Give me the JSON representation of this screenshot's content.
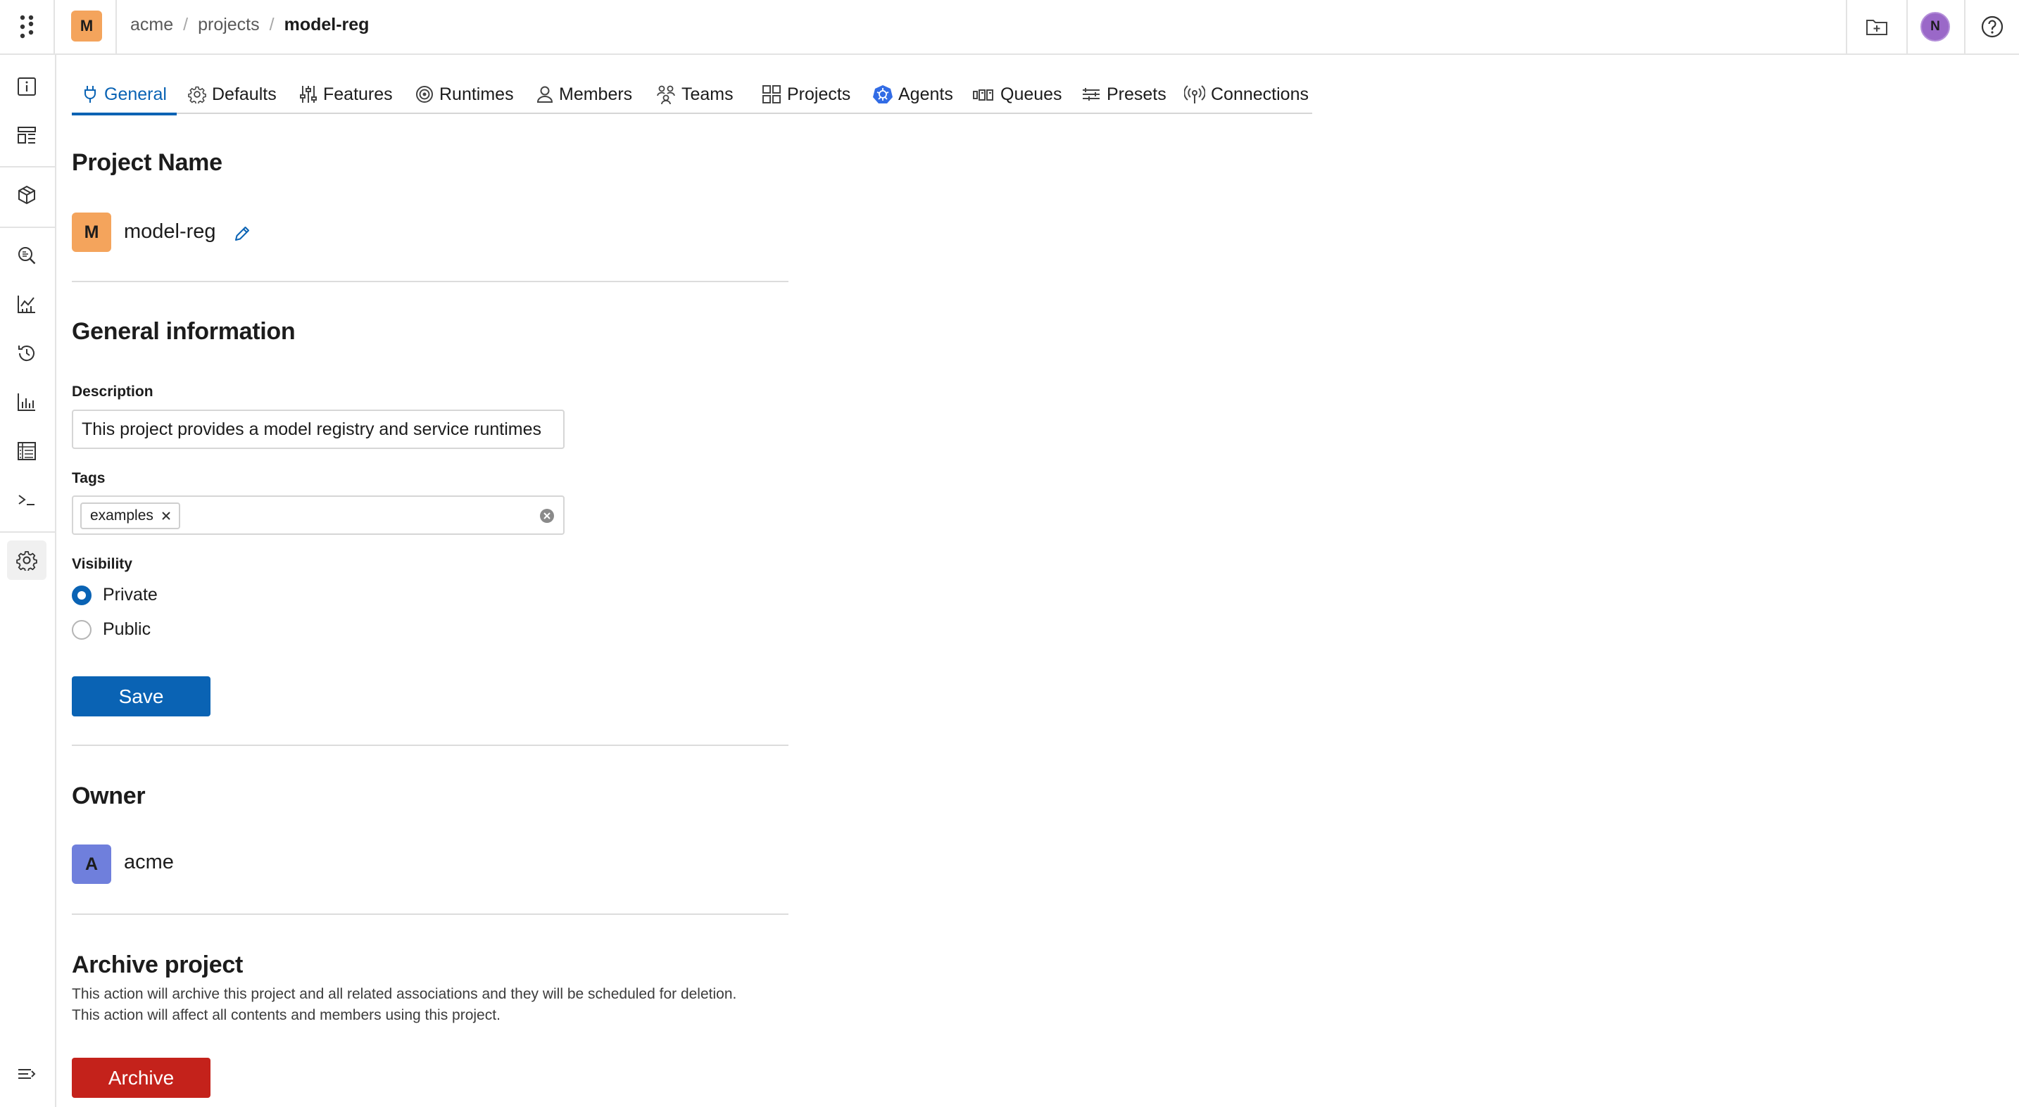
{
  "header": {
    "project_badge": "M",
    "breadcrumbs": [
      "acme",
      "projects",
      "model-reg"
    ],
    "separator": "/",
    "user_avatar": "N",
    "icons": [
      "apps-grid-icon",
      "new-folder-icon",
      "help-icon"
    ]
  },
  "sidebar": {
    "items": [
      {
        "icon": "info-icon"
      },
      {
        "icon": "dashboard-layout-icon"
      },
      {
        "icon": "package-icon"
      },
      {
        "icon": "search-report-icon"
      },
      {
        "icon": "line-chart-icon"
      },
      {
        "icon": "history-icon"
      },
      {
        "icon": "bar-chart-icon"
      },
      {
        "icon": "table-icon"
      },
      {
        "icon": "terminal-icon"
      },
      {
        "icon": "settings-icon",
        "active": true
      }
    ],
    "collapse_icon": "expand-sidebar-icon"
  },
  "tabs": [
    {
      "label": "General",
      "icon": "plug-icon",
      "active": true
    },
    {
      "label": "Defaults",
      "icon": "gear-icon"
    },
    {
      "label": "Features",
      "icon": "sliders-icon"
    },
    {
      "label": "Runtimes",
      "icon": "target-icon"
    },
    {
      "label": "Members",
      "icon": "person-icon"
    },
    {
      "label": "Teams",
      "icon": "team-icon"
    },
    {
      "label": "Projects",
      "icon": "grid-icon"
    },
    {
      "label": "Agents",
      "icon": "kubernetes-icon"
    },
    {
      "label": "Queues",
      "icon": "queue-icon"
    },
    {
      "label": "Presets",
      "icon": "presets-icon"
    },
    {
      "label": "Connections",
      "icon": "broadcast-icon"
    }
  ],
  "project_name": {
    "title": "Project Name",
    "badge": "M",
    "name": "model-reg"
  },
  "general_info": {
    "title": "General information",
    "description_label": "Description",
    "description_value": "This project provides a model registry and service runtimes",
    "tags_label": "Tags",
    "tags": [
      "examples"
    ],
    "visibility_label": "Visibility",
    "visibility_options": [
      "Private",
      "Public"
    ],
    "visibility_selected": "Private",
    "save_label": "Save"
  },
  "owner": {
    "title": "Owner",
    "badge": "A",
    "name": "acme"
  },
  "archive": {
    "title": "Archive project",
    "line1": "This action will archive this project and all related associations and they will be scheduled for deletion.",
    "line2": "This action will affect all contents and members using this project.",
    "button_label": "Archive"
  },
  "colors": {
    "primary": "#0a63b4",
    "danger": "#c4221b",
    "project_badge": "#f4a45c",
    "owner_badge": "#6f7fdc",
    "user_avatar": "#9a68c8"
  }
}
